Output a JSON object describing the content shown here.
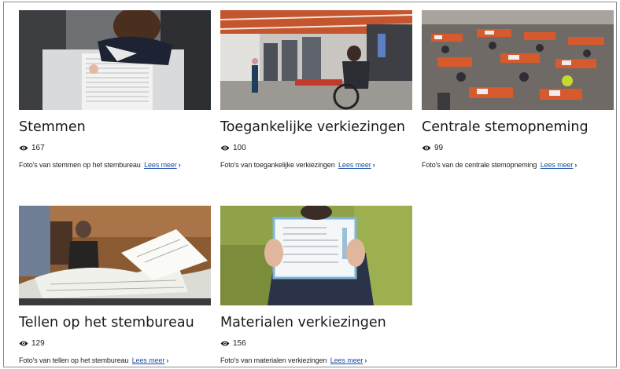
{
  "cards": [
    {
      "title": "Stemmen",
      "views": "167",
      "description": "Foto's van stemmen op het stembureau",
      "more_label": "Lees meer",
      "image_icon": "voting-booth-photo"
    },
    {
      "title": "Toegankelijke verkiezingen",
      "views": "100",
      "description": "Foto's van toegankelijke verkiezingen",
      "more_label": "Lees meer",
      "image_icon": "wheelchair-voter-photo"
    },
    {
      "title": "Centrale stemopneming",
      "views": "99",
      "description": "Foto's van de centrale stemopneming",
      "more_label": "Lees meer",
      "image_icon": "counting-hall-photo"
    },
    {
      "title": "Tellen op het stembureau",
      "views": "129",
      "description": "Foto's van tellen op het stembureau",
      "more_label": "Lees meer",
      "image_icon": "ballot-pile-photo"
    },
    {
      "title": "Materialen verkiezingen",
      "views": "156",
      "description": "Foto's van materialen verkiezingen",
      "more_label": "Lees meer",
      "image_icon": "stempas-photo"
    }
  ],
  "icons": {
    "views": "eye-icon",
    "more": "chevron-right-icon"
  },
  "colors": {
    "link": "#1b4ea3",
    "text": "#1a1a1a",
    "border": "#8a8a8a"
  }
}
